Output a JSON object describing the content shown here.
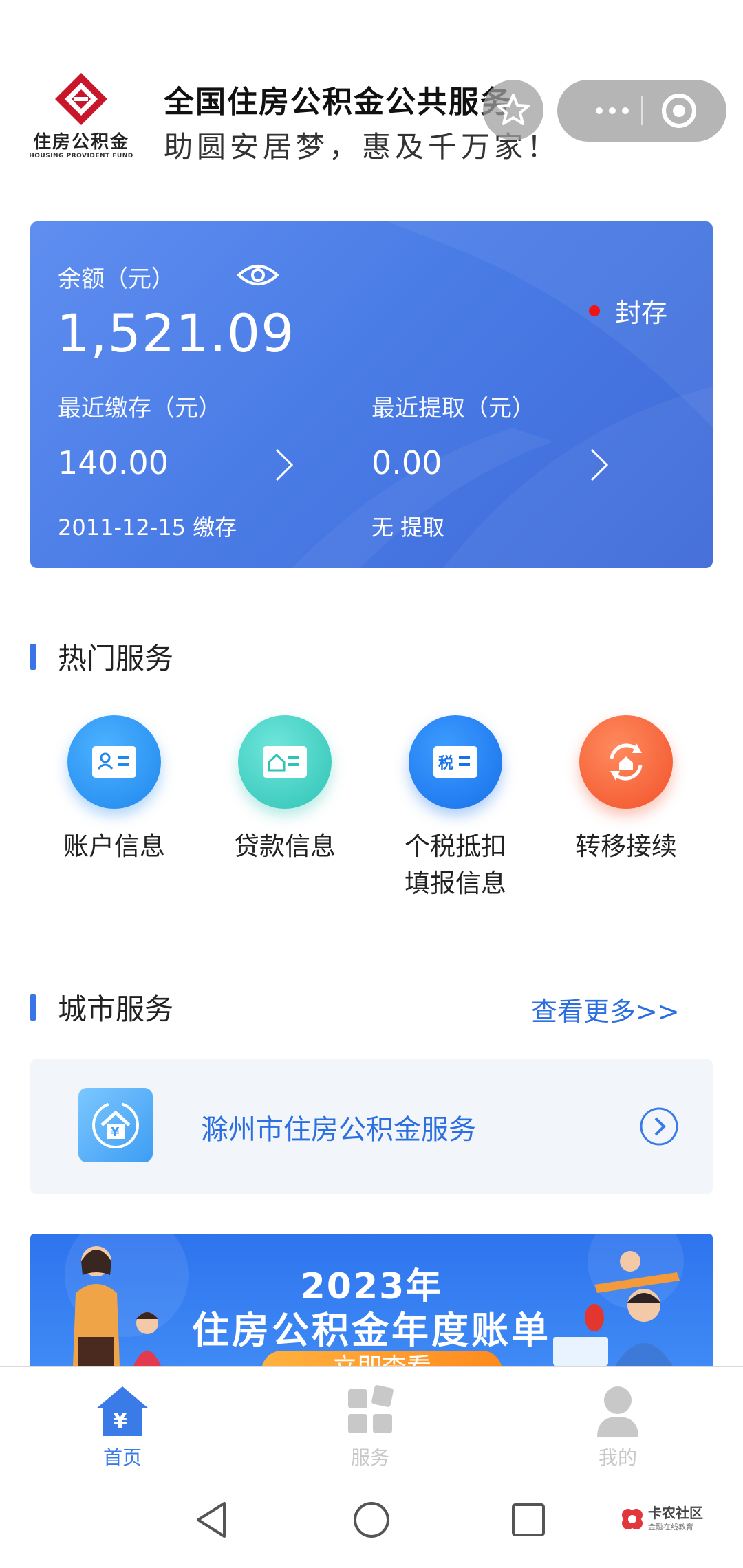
{
  "header": {
    "logo_text": "住房公积金",
    "logo_sub": "HOUSING PROVIDENT FUND",
    "title": "全国住房公积金公共服务",
    "slogan": "助圆安居梦，惠及千万家！"
  },
  "balance_card": {
    "balance_label": "余额（元）",
    "balance_value": "1,521.09",
    "status": "封存",
    "recent_deposit_label": "最近缴存（元）",
    "recent_deposit_value": "140.00",
    "recent_deposit_note": "2011-12-15 缴存",
    "recent_withdraw_label": "最近提取（元）",
    "recent_withdraw_value": "0.00",
    "recent_withdraw_note": "无 提取"
  },
  "hot_services": {
    "title": "热门服务",
    "items": [
      {
        "label": "账户信息",
        "icon": "account-card-icon",
        "color": "#2f9bf2"
      },
      {
        "label": "贷款信息",
        "icon": "loan-card-icon",
        "color": "#43d2c6"
      },
      {
        "label": "个税抵扣\n填报信息",
        "icon": "tax-card-icon",
        "color": "#2b86f0"
      },
      {
        "label": "转移接续",
        "icon": "transfer-house-icon",
        "color": "#fb6a3d"
      }
    ],
    "tax_badge": "税"
  },
  "city_services": {
    "title": "城市服务",
    "more_link": "查看更多>>",
    "item_label": "滁州市住房公积金服务"
  },
  "banner": {
    "year": "2023年",
    "title": "住房公积金年度账单",
    "button": "立即查看"
  },
  "tabbar": {
    "items": [
      {
        "label": "首页",
        "active": true
      },
      {
        "label": "服务",
        "active": false
      },
      {
        "label": "我的",
        "active": false
      }
    ]
  },
  "watermark": {
    "text": "卡农社区",
    "sub": "金融在线教育"
  },
  "colors": {
    "accent": "#2c6fe0",
    "card_start": "#5f8ef0",
    "card_end": "#3e6ad8",
    "status_dot": "#f01414",
    "tab_active": "#3b7be8",
    "tab_inactive": "#c8c8c8"
  }
}
